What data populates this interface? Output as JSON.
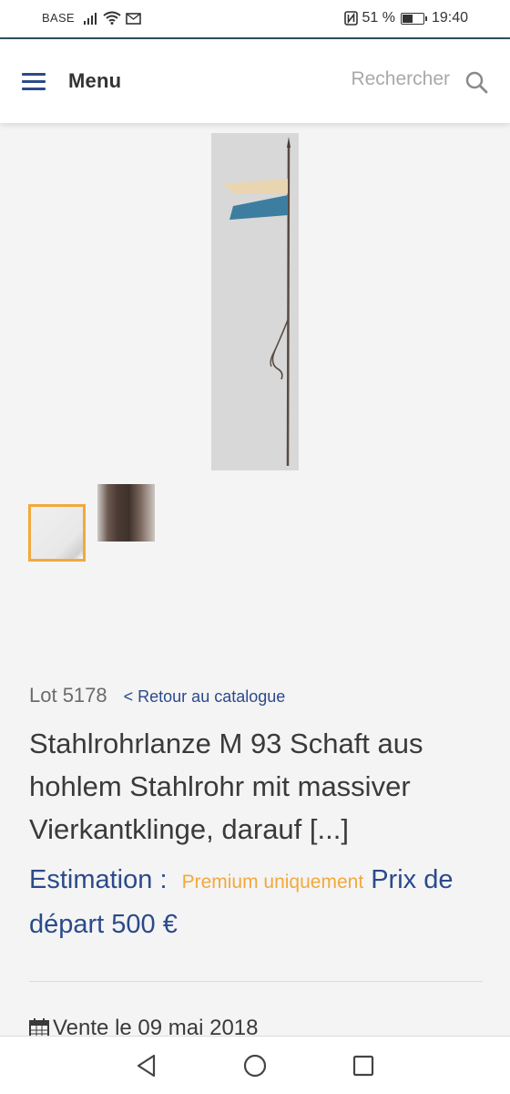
{
  "status_bar": {
    "carrier": "BASE",
    "battery_percent": "51 %",
    "battery_level": 0.51,
    "time": "19:40",
    "icons": [
      "signal-icon",
      "wifi-icon",
      "message-icon",
      "nfc-icon",
      "battery-icon"
    ]
  },
  "header": {
    "menu_label": "Menu",
    "search_placeholder": "Rechercher"
  },
  "lot": {
    "number": "Lot 5178",
    "back_link": "< Retour au catalogue",
    "title": "Stahlrohrlanze M 93 Schaft aus hohlem Stahlrohr mit massiver Vierkantklinge, darauf [...]",
    "estimation_label": "Estimation :",
    "premium_label": "Premium uniquement",
    "start_price": "Prix de départ 500 €",
    "sale_date": "Vente le 09 mai 2018"
  },
  "colors": {
    "accent_blue": "#2b4a8b",
    "premium_orange": "#f2a93b",
    "thumb_selected_border": "#f2a93b"
  },
  "nav": {
    "icons": [
      "back-triangle-icon",
      "home-circle-icon",
      "recents-square-icon"
    ]
  }
}
